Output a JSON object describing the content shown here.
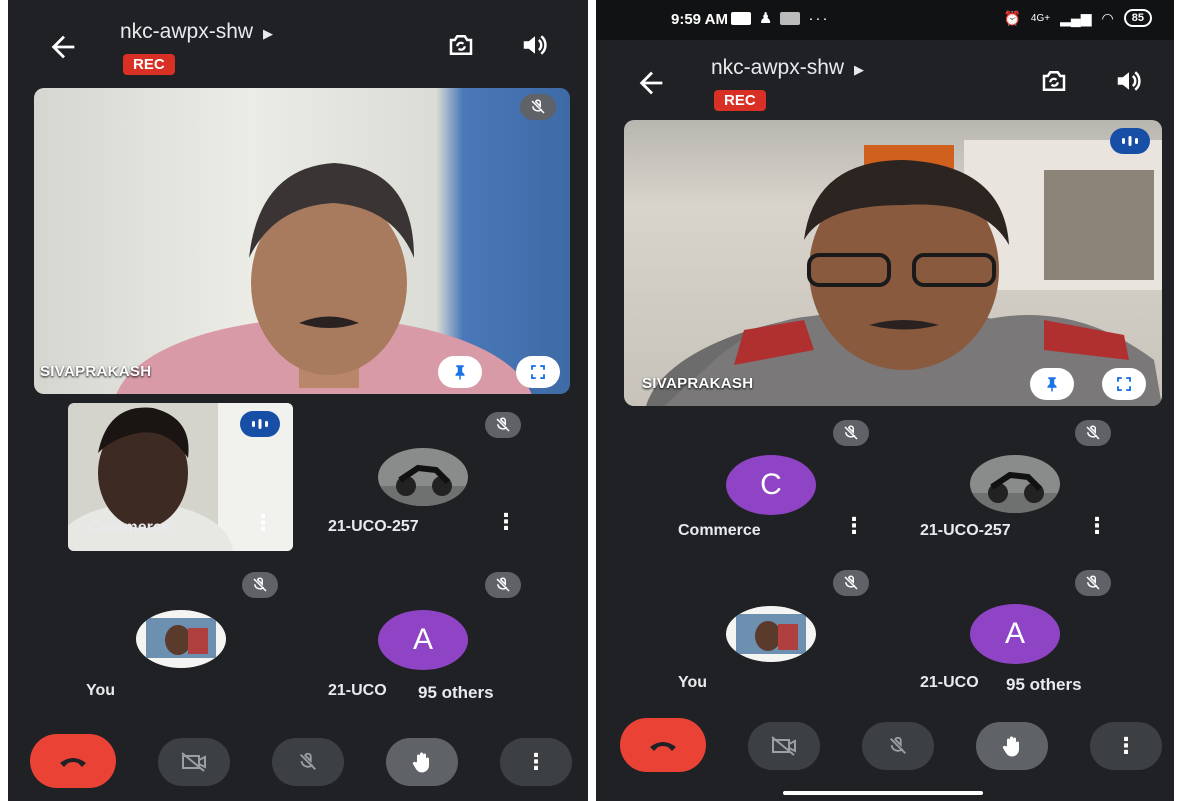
{
  "left_screen": {
    "header": {
      "meeting_code": "nkc-awpx-shw",
      "rec_label": "REC"
    },
    "main_tile": {
      "name": "SIVAPRAKASH"
    },
    "participants": [
      {
        "name": "Commerce"
      },
      {
        "name": "21-UCO-257"
      },
      {
        "name": "You"
      },
      {
        "name": "21-UCO",
        "letter": "A"
      }
    ],
    "others_label": "95 others"
  },
  "right_screen": {
    "statusbar": {
      "time": "9:59 AM",
      "dots": "···",
      "network": "4G+",
      "battery": "85"
    },
    "header": {
      "meeting_code": "nkc-awpx-shw",
      "rec_label": "REC"
    },
    "main_tile": {
      "name": "SIVAPRAKASH"
    },
    "participants": [
      {
        "name": "Commerce",
        "letter": "C"
      },
      {
        "name": "21-UCO-257"
      },
      {
        "name": "You"
      },
      {
        "name": "21-UCO",
        "letter": "A"
      }
    ],
    "others_label": "95 others"
  },
  "colors": {
    "background": "#202124",
    "rec": "#d93025",
    "end_call": "#ea4335",
    "avatar_purple": "#8e44c4",
    "speaking": "#174ea6"
  },
  "icons": [
    "back-arrow-icon",
    "play-triangle-icon",
    "switch-camera-icon",
    "speaker-icon",
    "mic-off-icon",
    "speaking-indicator-icon",
    "pin-icon",
    "fullscreen-icon",
    "more-vert-icon",
    "end-call-icon",
    "camera-off-icon",
    "raise-hand-icon"
  ]
}
